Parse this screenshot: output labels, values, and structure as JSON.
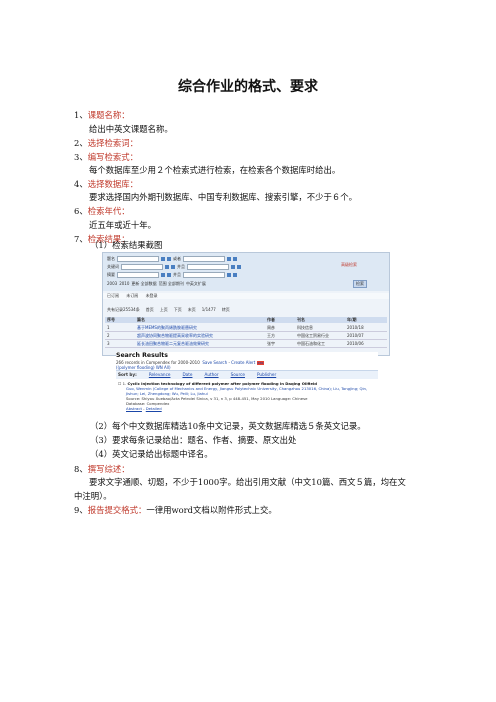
{
  "doc": {
    "title": "综合作业的格式、要求",
    "items": [
      {
        "num": "1、",
        "label": "课题名称：",
        "sub": "给出中英文课题名称。"
      },
      {
        "num": "2、",
        "label": "选择检索词：",
        "sub": ""
      },
      {
        "num": "3、",
        "label": "编写检索式：",
        "sub": "每个数据库至少用２个检索式进行检索，在检索各个数据库时给出。"
      },
      {
        "num": "4、",
        "label": "选择数据库：",
        "sub": "要求选择国内外期刊数据库、中国专利数据库、搜索引擎，不少于６个。"
      },
      {
        "num": "6、",
        "label": "检索年代：",
        "sub": "近五年或近十年。"
      },
      {
        "num": "7、",
        "label": "检索结果：",
        "sub": "（1）检索结果截图"
      }
    ],
    "after_shots": [
      "（2）每个中文数据库精选10条中文记录，英文数据库精选５条英文记录。",
      "（3）要求每条记录给出：题名、作者、摘要、原文出处",
      "（4）英文记录给出标题中译名。"
    ],
    "item8": {
      "num": "8、",
      "label": "撰写综述：",
      "line1": "要求文字通顺、切题，不少于1000字。给出引用文献（中文10篇、西文５篇，均在文",
      "line2": "中注明）。"
    },
    "item9": {
      "num": "9、",
      "label": "报告提交格式：",
      "text": "一律用word文档以附件形式上交。"
    }
  },
  "shot1": {
    "fields": [
      "题名",
      "关键词",
      "摘要"
    ],
    "opts": [
      "或者",
      "并且",
      "并且"
    ],
    "years": [
      "2003",
      "2010"
    ],
    "sort": "更新 全部数据",
    "scope": "范围 全部期刊",
    "lang": "中英文扩展",
    "search_btn": "检索",
    "buttons": [
      "已订阅",
      "未订阅",
      "未登录"
    ],
    "count": "共有记录25534条",
    "pager": [
      "首页",
      "上页",
      "下页",
      "末页"
    ],
    "page": "1/1477",
    "go": "转页",
    "right_link": "高级检索",
    "columns": [
      "序号",
      "篇名",
      "作者",
      "刊名",
      "年/期"
    ],
    "rows": [
      {
        "n": "1",
        "title": "基于MEMS的聚丙烯酰胺驱替研究",
        "author": "周彦",
        "journal": "科技信息",
        "year": "2010/18"
      },
      {
        "n": "2",
        "title": "超声波协同聚合物驱提高采收率的实验研究",
        "author": "王方",
        "journal": "中国化工贸易行业",
        "year": "2010/07"
      },
      {
        "n": "3",
        "title": "延长油田聚合物驱二元复合驱油效果研究",
        "author": "张宇",
        "journal": "中国石油和化工",
        "year": "2010/06"
      }
    ]
  },
  "shot2": {
    "heading": "Search Results",
    "sub_text": "266 records in Compendex for 2000-2010",
    "save": "Save Search",
    "alert": "Create Alert",
    "rss": "RSS",
    "refine": "((polymer flooding) WN All)",
    "sort_label": "Sort by:",
    "sort_opts": [
      "Relevance",
      "Date",
      "Author",
      "Source",
      "Publisher"
    ],
    "record": {
      "num": "1.",
      "title": "Cyclic injection technology of different polymer after polymer flooding in Daqing Oilfield",
      "authors": "Guo, Wenmin (College of Mechanics and Energy, Jiangsu Polytechnic University, Changzhou 213016, China); Liu, Tongjing; Qin, Jishun; Lei, Zhengdong; Wu, Peili; Lu, Jiahui",
      "source": "Source: Shiyou Xuebao/Acta Petrolei Sinica, v 31, n 3, p 448-451, May 2010 Language: Chinese",
      "db": "Database: Compendex",
      "links": [
        "Abstract",
        "Detailed"
      ]
    }
  }
}
